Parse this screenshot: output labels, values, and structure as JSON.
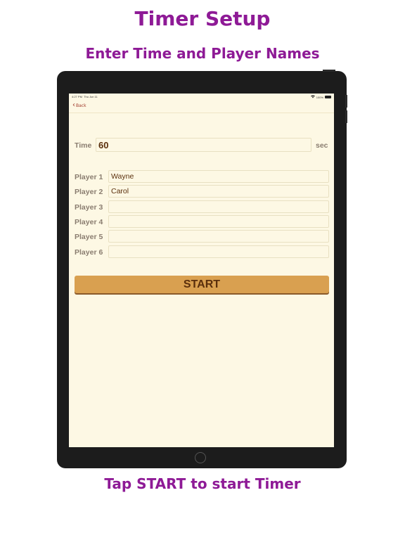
{
  "promo": {
    "title": "Timer Setup",
    "subtitle": "Enter Time and Player Names",
    "caption": "Tap START to start Timer"
  },
  "statusbar": {
    "time": "4:27 PM",
    "date": "Thu Jun 11",
    "battery": "100%"
  },
  "nav": {
    "back_label": "Back"
  },
  "form": {
    "time_label": "Time",
    "time_value": "60",
    "time_unit": "sec",
    "players": [
      {
        "label": "Player 1",
        "value": "Wayne"
      },
      {
        "label": "Player 2",
        "value": "Carol"
      },
      {
        "label": "Player 3",
        "value": ""
      },
      {
        "label": "Player 4",
        "value": ""
      },
      {
        "label": "Player 5",
        "value": ""
      },
      {
        "label": "Player 6",
        "value": ""
      }
    ],
    "start_label": "START"
  },
  "colors": {
    "promo_text": "#8e1a96",
    "screen_bg": "#fdf8e4",
    "button_bg": "#d9a050",
    "input_text": "#5a2f0c",
    "back_link": "#a0392a"
  },
  "icons": {
    "back": "chevron-left-icon",
    "wifi": "wifi-icon",
    "battery": "battery-icon",
    "home": "home-button-icon"
  }
}
